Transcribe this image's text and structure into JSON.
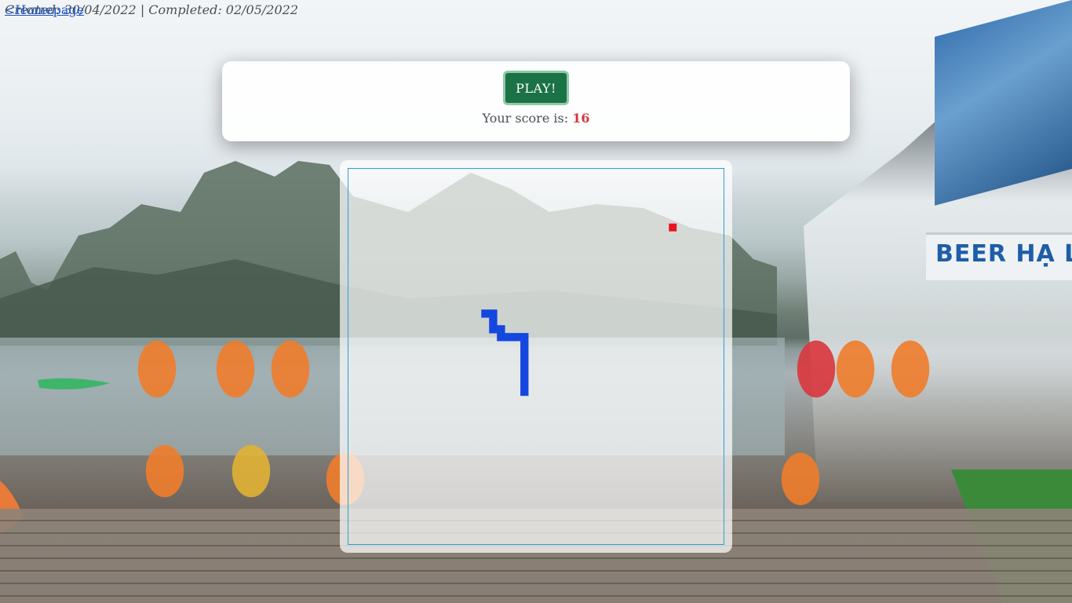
{
  "header": {
    "home_link": "<Homepage",
    "caption": "Created: 30/04/2022 | Completed: 02/05/2022"
  },
  "controls": {
    "play_label": "PLAY!",
    "score_label": "Your score is: ",
    "score": "16"
  },
  "background": {
    "sign_text": "BEER HẠ L"
  },
  "game": {
    "grid_cells": 48,
    "snake_color": "#1446e0",
    "food_color": "#e8141e",
    "board_border_color": "#2a9fd6",
    "food": [
      41,
      7
    ],
    "snake": [
      [
        17,
        18
      ],
      [
        18,
        18
      ],
      [
        18,
        19
      ],
      [
        18,
        20
      ],
      [
        19,
        20
      ],
      [
        19,
        21
      ],
      [
        20,
        21
      ],
      [
        21,
        21
      ],
      [
        22,
        21
      ],
      [
        22,
        22
      ],
      [
        22,
        23
      ],
      [
        22,
        24
      ],
      [
        22,
        25
      ],
      [
        22,
        26
      ],
      [
        22,
        27
      ],
      [
        22,
        28
      ]
    ]
  }
}
